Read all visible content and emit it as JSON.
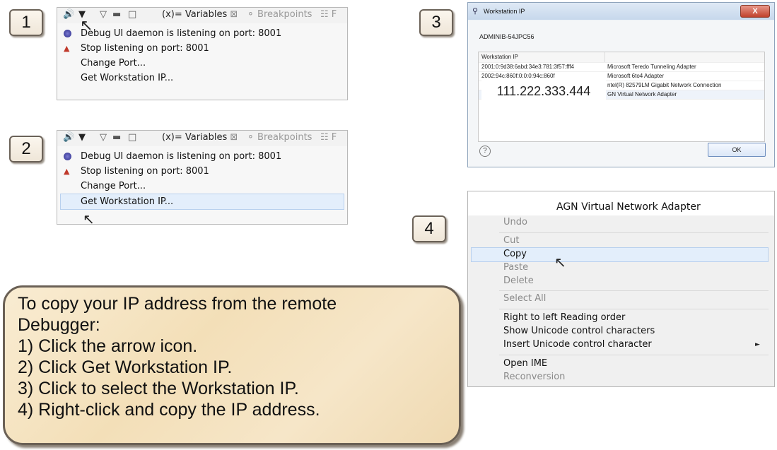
{
  "steps": [
    "1",
    "2",
    "3",
    "4"
  ],
  "eclipse": {
    "tab_variables": "(x)= Variables",
    "tab_variables_close": "⊠",
    "tab_breakpoints": "Breakpoints",
    "tab_more": "F",
    "menu_items": [
      "Debug UI daemon is listening on port: 8001",
      "Stop listening on port: 8001",
      "Change Port...",
      "Get Workstation IP..."
    ]
  },
  "dialog": {
    "title": "Workstation IP",
    "close_label": "X",
    "host": "ADMINIB-54JPC56",
    "column_header": "Workstation IP",
    "rows": [
      {
        "ip": "2001:0:9d38:6abd:34e3:781:3f57:fff4",
        "adapter": "Microsoft Teredo Tunneling Adapter"
      },
      {
        "ip": "2002:94c:860f:0:0:0:94c:860f",
        "adapter": "Microsoft 6to4 Adapter"
      },
      {
        "ip": "",
        "adapter": "ntel(R) 82579LM Gigabit Network Connection"
      },
      {
        "ip": "",
        "adapter": "GN Virtual Network Adapter"
      }
    ],
    "highlight_ip": "111.222.333.444",
    "help_icon": "?",
    "ok_label": "OK"
  },
  "context_menu": {
    "header": "AGN Virtual Network Adapter",
    "items": {
      "undo": "Undo",
      "cut": "Cut",
      "copy": "Copy",
      "paste": "Paste",
      "delete": "Delete",
      "select_all": "Select All",
      "rtl": "Right to left Reading order",
      "show_unicode": "Show Unicode control characters",
      "insert_unicode": "Insert Unicode control character",
      "open_ime": "Open IME",
      "reconversion": "Reconversion"
    }
  },
  "instructions": {
    "intro_line1": "To copy your IP address from the remote",
    "intro_line2": "Debugger:",
    "steps": [
      "1)  Click the arrow icon.",
      "2)  Click Get Workstation IP.",
      "3)  Click to select the Workstation IP.",
      "4)  Right-click and copy the IP address."
    ]
  },
  "colors": {
    "badge_border": "#6b6258",
    "note_bg": "#f3dfb8",
    "selection": "#e3eefb"
  }
}
